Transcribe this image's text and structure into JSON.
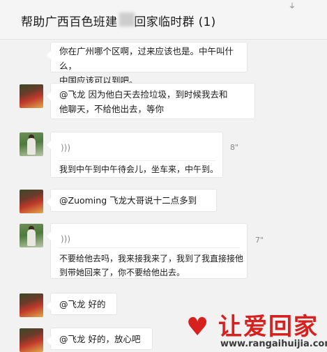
{
  "header": {
    "title_prefix": "帮助广西百色班建",
    "title_suffix": "回家临时群 (1)",
    "pin_icon": "pin-icon"
  },
  "messages": [
    {
      "type": "text",
      "text_lines": [
        "你在广州哪个区啊，过来应该也是。中午叫什么，",
        "中国应该可以到吧。"
      ]
    },
    {
      "type": "text",
      "avatar": "red",
      "text_lines": [
        "@飞龙 因为他白天去捡垃圾，到时候我去和",
        "他聊天，不给他出去，等你"
      ]
    },
    {
      "type": "voice",
      "avatar": "green",
      "duration": "8\"",
      "transcript": "我到中午到中午待会儿，坐车来，中午到。"
    },
    {
      "type": "text",
      "avatar": "red",
      "text_lines": [
        "@Zuoming 飞龙大哥说十二点多到"
      ]
    },
    {
      "type": "voice",
      "avatar": "green",
      "duration": "7\"",
      "transcript_lines": [
        "不要给他去吗，我来接我来了，我到了我直接接他",
        "到带她回来了，你不要给他出去。"
      ]
    },
    {
      "type": "text",
      "avatar": "red",
      "text_lines": [
        "@飞龙 好的"
      ]
    },
    {
      "type": "text",
      "avatar": "red",
      "text_lines": [
        "@飞龙 好的，放心吧"
      ]
    }
  ],
  "watermark": {
    "chinese": "让爱回家",
    "url": "www.rangaihuijia.com",
    "color": "#d6211f"
  }
}
